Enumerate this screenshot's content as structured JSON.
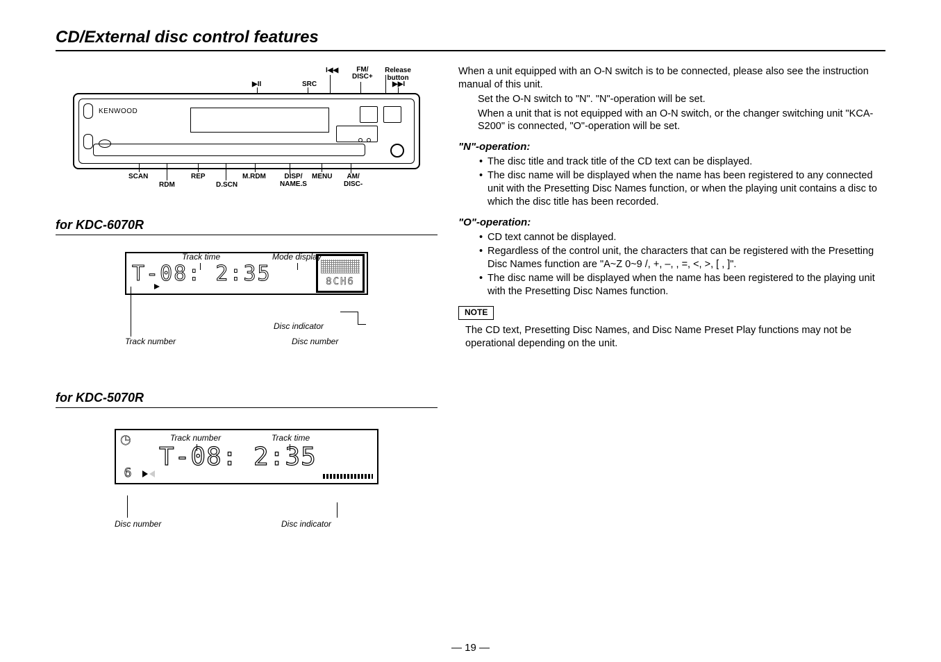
{
  "page": {
    "title": "CD/External disc control features",
    "number": "— 19 —"
  },
  "faceplate": {
    "brand": "KENWOOD",
    "top_labels": {
      "play_pause": "▶II",
      "src": "SRC",
      "prev": "I◀◀",
      "fm_disc_plus": "FM/\nDISC+",
      "release": "Release button",
      "next": "▶▶I"
    },
    "bottom_labels": {
      "scan": "SCAN",
      "rdm": "RDM",
      "rep": "REP",
      "dscn": "D.SCN",
      "mrdm": "M.RDM",
      "disp_names": "DISP/\nNAME.S",
      "menu": "MENU",
      "am_disc_minus": "AM/\nDISC-"
    }
  },
  "section_6070": {
    "heading": "for KDC-6070R",
    "labels": {
      "track_time": "Track time",
      "mode_display": "Mode display",
      "track_number": "Track number",
      "disc_indicator": "Disc indicator",
      "disc_number": "Disc number"
    },
    "lcd_text": "T-08: 2:35",
    "ch_text": "8CH6"
  },
  "section_5070": {
    "heading": "for KDC-5070R",
    "labels": {
      "track_number": "Track number",
      "track_time": "Track time",
      "disc_number": "Disc number",
      "disc_indicator": "Disc indicator"
    },
    "disc_num": "6",
    "lcd_text": "T-08: 2:35"
  },
  "right_column": {
    "intro": [
      "When a unit equipped with an O-N switch is to be connected, please also see the instruction manual of this unit.",
      "Set the O-N switch to \"N\". \"N\"-operation will be set.",
      "When a unit that is not equipped with an O-N switch, or the changer switching unit \"KCA-S200\" is connected, \"O\"-operation will be set."
    ],
    "n_operation": {
      "heading": "\"N\"-operation:",
      "bullets": [
        "The disc title and track title of the CD text can be displayed.",
        "The disc name will be displayed when the name has been registered to any connected unit with the Presetting Disc Names function, or when the playing unit contains a disc to which the disc title has been recorded."
      ]
    },
    "o_operation": {
      "heading": "\"O\"-operation:",
      "bullets": [
        "CD text cannot be displayed.",
        "Regardless of the control unit, the characters that can be registered with the Presetting Disc Names function are \"A~Z  0~9  /, +, –,   , =, <, >, [ , ]\".",
        "The disc name will be displayed when the name has been registered to the playing unit with the Presetting Disc Names function."
      ]
    },
    "note": {
      "label": "NOTE",
      "text": "The CD text, Presetting Disc Names, and Disc Name Preset Play functions may not be operational depending on the unit."
    }
  }
}
